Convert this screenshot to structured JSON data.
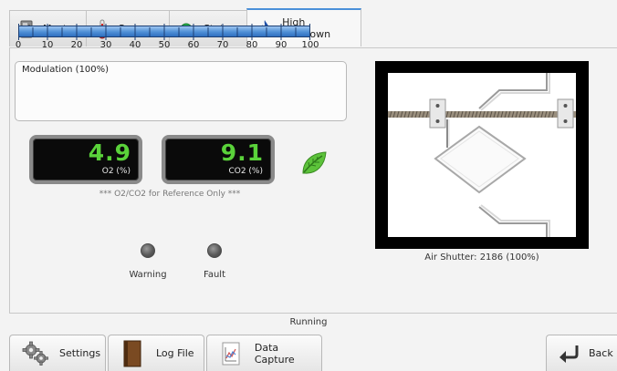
{
  "tabs": [
    {
      "label": "Master",
      "icon": "master-panel-icon"
    },
    {
      "label": "Sensors",
      "icon": "thermometer-icon"
    },
    {
      "label": "Status",
      "icon": "status-dot-icon"
    },
    {
      "label": "High Turndown",
      "icon": "flame-icon",
      "active": true
    }
  ],
  "modulation": {
    "title": "Modulation (100%)",
    "percent": 100,
    "scale": [
      "0",
      "10",
      "20",
      "30",
      "40",
      "50",
      "60",
      "70",
      "80",
      "90",
      "100"
    ]
  },
  "readings": [
    {
      "value": "4.9",
      "unit": "O2 (%)"
    },
    {
      "value": "9.1",
      "unit": "CO2 (%)"
    }
  ],
  "note": "*** O2/CO2 for Reference Only ***",
  "indicators": {
    "warning": "Warning",
    "fault": "Fault"
  },
  "air_shutter": {
    "caption": "Air Shutter: 2186 (100%)"
  },
  "status_text": "Running",
  "buttons": {
    "settings": "Settings",
    "log_file": "Log File",
    "data_capture": "Data Capture",
    "back": "Back"
  },
  "colors": {
    "reading_value": "#5ad23a",
    "leaf": "#5cc23a",
    "active_tab_accent": "#4a90d9",
    "modulation_bar": "#4f8fd6"
  }
}
